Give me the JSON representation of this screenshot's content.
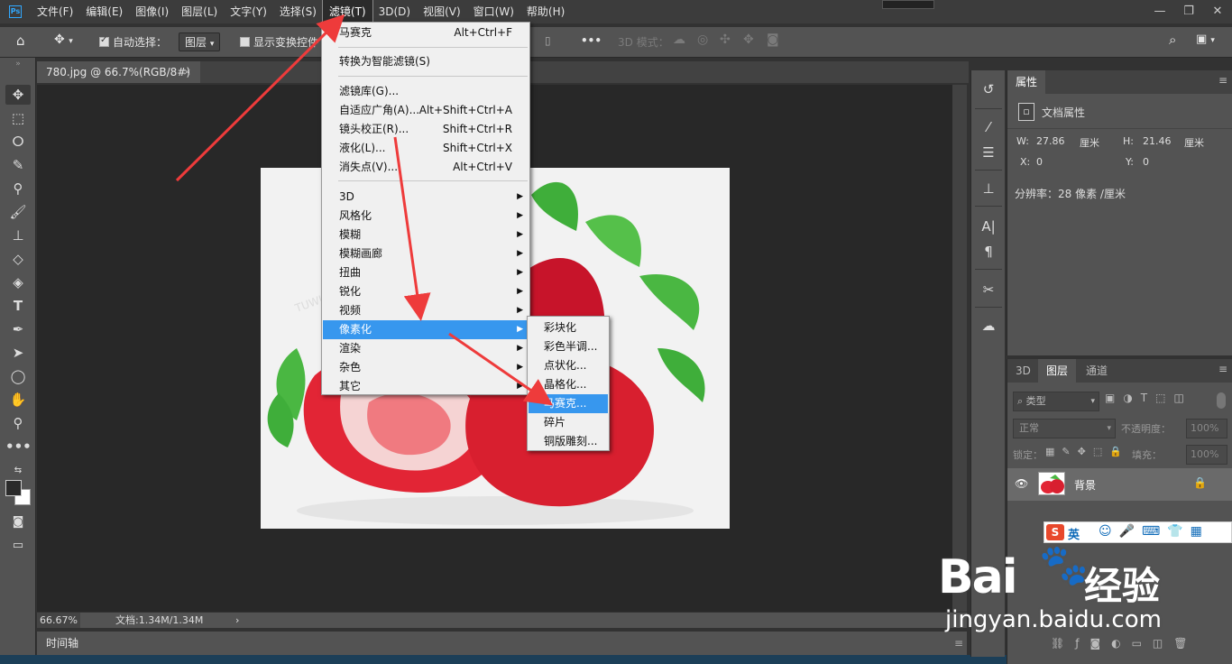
{
  "app": {
    "logo": "Ps"
  },
  "menubar": {
    "items": [
      "文件(F)",
      "编辑(E)",
      "图像(I)",
      "图层(L)",
      "文字(Y)",
      "选择(S)",
      "滤镜(T)",
      "3D(D)",
      "视图(V)",
      "窗口(W)",
      "帮助(H)"
    ],
    "active_index": 6
  },
  "window_controls": {
    "minimize": "—",
    "restore": "❐",
    "close": "✕"
  },
  "options_bar": {
    "auto_select_label": "自动选择：",
    "auto_select_value": "图层",
    "show_transform_label": "显示变换控件",
    "mode_3d_label": "3D 模式："
  },
  "document": {
    "tab_title": "780.jpg @ 66.7%(RGB/8#)",
    "close": "×"
  },
  "status": {
    "zoom": "66.67%",
    "doc_size": "文档:1.34M/1.34M",
    "arrow": "›"
  },
  "timeline": {
    "label": "时间轴"
  },
  "filter_menu": {
    "items": [
      {
        "label": "马赛克",
        "shortcut": "Alt+Ctrl+F"
      },
      {
        "label": "转换为智能滤镜(S)",
        "shortcut": ""
      },
      {
        "label": "滤镜库(G)...",
        "shortcut": ""
      },
      {
        "label": "自适应广角(A)...",
        "shortcut": "Alt+Shift+Ctrl+A"
      },
      {
        "label": "镜头校正(R)...",
        "shortcut": "Shift+Ctrl+R"
      },
      {
        "label": "液化(L)...",
        "shortcut": "Shift+Ctrl+X"
      },
      {
        "label": "消失点(V)...",
        "shortcut": "Alt+Ctrl+V"
      },
      {
        "label": "3D",
        "shortcut": ""
      },
      {
        "label": "风格化",
        "shortcut": ""
      },
      {
        "label": "模糊",
        "shortcut": ""
      },
      {
        "label": "模糊画廊",
        "shortcut": ""
      },
      {
        "label": "扭曲",
        "shortcut": ""
      },
      {
        "label": "锐化",
        "shortcut": ""
      },
      {
        "label": "视频",
        "shortcut": ""
      },
      {
        "label": "像素化",
        "shortcut": ""
      },
      {
        "label": "渲染",
        "shortcut": ""
      },
      {
        "label": "杂色",
        "shortcut": ""
      },
      {
        "label": "其它",
        "shortcut": ""
      }
    ],
    "submenu_arrow": "▶"
  },
  "pixelate_submenu": {
    "items": [
      "彩块化",
      "彩色半调...",
      "点状化...",
      "晶格化...",
      "马赛克...",
      "碎片",
      "铜版雕刻..."
    ],
    "highlight_index": 4
  },
  "properties_panel": {
    "tab": "属性",
    "doc_props_label": "文档属性",
    "w_label": "W:",
    "w_value": "27.86",
    "w_unit": "厘米",
    "h_label": "H:",
    "h_value": "21.46",
    "h_unit": "厘米",
    "x_label": "X:",
    "x_value": "0",
    "y_label": "Y:",
    "y_value": "0",
    "resolution": "分辨率：28 像素 /厘米"
  },
  "layers_panel": {
    "tabs": [
      "3D",
      "图层",
      "通道"
    ],
    "active_tab": 1,
    "filter_type": "类型",
    "blend_mode": "正常",
    "opacity_label": "不透明度：",
    "opacity_value": "100%",
    "lock_label": "锁定：",
    "fill_label": "填充：",
    "fill_value": "100%",
    "layer_name": "背景"
  },
  "ime": {
    "lang": "英"
  },
  "watermark": {
    "brand": "Bai",
    "brand2": "经验",
    "url": "jingyan.baidu.com"
  },
  "colors": {
    "accent": "#3797ee",
    "annotation_arrow": "#ee3b3b"
  }
}
